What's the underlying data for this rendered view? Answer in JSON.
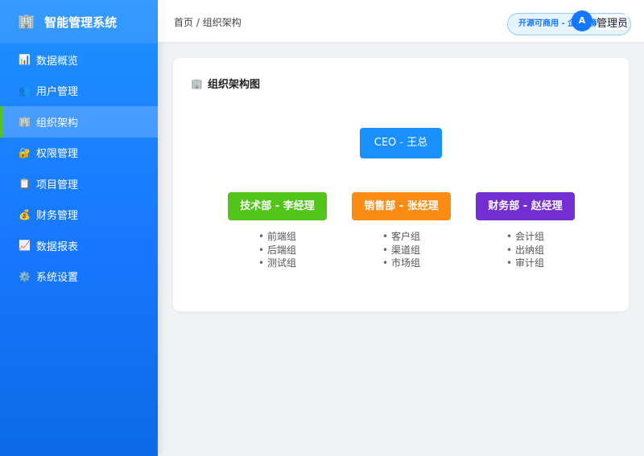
{
  "app": {
    "icon": "building-icon",
    "title": "智能管理系统"
  },
  "sidebar": {
    "items": [
      {
        "icon": "chart-icon",
        "glyph": "📊",
        "label": "数据概览"
      },
      {
        "icon": "users-icon",
        "glyph": "👥",
        "label": "用户管理"
      },
      {
        "icon": "building-icon",
        "glyph": "🏢",
        "label": "组织架构",
        "active": true
      },
      {
        "icon": "lock-icon",
        "glyph": "🔐",
        "label": "权限管理"
      },
      {
        "icon": "clipboard-icon",
        "glyph": "📋",
        "label": "项目管理"
      },
      {
        "icon": "money-bag-icon",
        "glyph": "💰",
        "label": "财务管理"
      },
      {
        "icon": "trend-chart-icon",
        "glyph": "📈",
        "label": "数据报表"
      },
      {
        "icon": "gear-icon",
        "glyph": "⚙️",
        "label": "系统设置"
      }
    ]
  },
  "header": {
    "breadcrumb": {
      "home": "首页",
      "separator": " / ",
      "current": "组织架构"
    },
    "badge": "开源可商用 - 企业级解决方案",
    "avatar_letter": "A",
    "username": "管理员"
  },
  "main": {
    "title": "组织架构图",
    "title_icon": "building-icon",
    "ceo": "CEO - 王总",
    "departments": [
      {
        "label": "技术部 - 李经理",
        "color": "#52c41a",
        "teams": [
          "前端组",
          "后端组",
          "测试组"
        ]
      },
      {
        "label": "销售部 - 张经理",
        "color": "#fa8c16",
        "teams": [
          "客户组",
          "渠道组",
          "市场组"
        ]
      },
      {
        "label": "财务部 - 赵经理",
        "color": "#722ed1",
        "teams": [
          "会计组",
          "出纳组",
          "审计组"
        ]
      }
    ]
  },
  "colors": {
    "primary": "#1677ff",
    "ceo": "#1890ff",
    "active_indicator": "#52c41a"
  }
}
